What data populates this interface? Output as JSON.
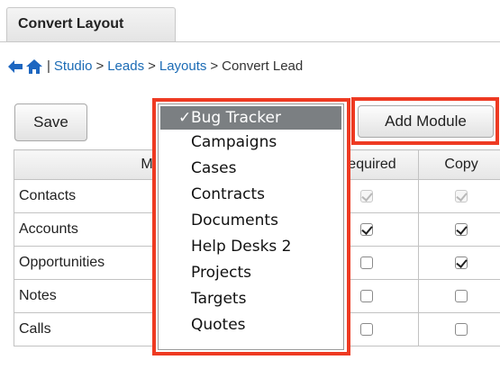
{
  "tab": {
    "label": "Convert Layout"
  },
  "breadcrumb": {
    "sep": "|",
    "items": [
      {
        "label": "Studio",
        "link": true
      },
      {
        "label": ">",
        "link": false
      },
      {
        "label": "Leads",
        "link": true
      },
      {
        "label": ">",
        "link": false
      },
      {
        "label": "Layouts",
        "link": true
      },
      {
        "label": ">",
        "link": false
      },
      {
        "label": "Convert Lead",
        "link": false
      }
    ]
  },
  "toolbar": {
    "save_label": "Save",
    "add_module_label": "Add Module"
  },
  "table": {
    "headers": {
      "module": "Module",
      "required": "Required",
      "copy": "Copy"
    },
    "rows": [
      {
        "module": "Contacts",
        "required": true,
        "required_disabled": true,
        "copy": true,
        "copy_disabled": true
      },
      {
        "module": "Accounts",
        "required": true,
        "required_disabled": false,
        "copy": true,
        "copy_disabled": false
      },
      {
        "module": "Opportunities",
        "required": false,
        "required_disabled": false,
        "copy": true,
        "copy_disabled": false
      },
      {
        "module": "Notes",
        "required": false,
        "required_disabled": false,
        "copy": false,
        "copy_disabled": false
      },
      {
        "module": "Calls",
        "required": false,
        "required_disabled": false,
        "copy": false,
        "copy_disabled": false
      }
    ]
  },
  "module_dropdown": {
    "check_mark": "✓",
    "selected_index": 0,
    "options": [
      "Bug Tracker",
      "Campaigns",
      "Cases",
      "Contracts",
      "Documents",
      "Help Desks 2",
      "Projects",
      "Targets",
      "Quotes"
    ]
  },
  "colors": {
    "highlight": "#ee3a22",
    "link": "#1b6bb5",
    "selected_bg": "#7b7f82"
  }
}
